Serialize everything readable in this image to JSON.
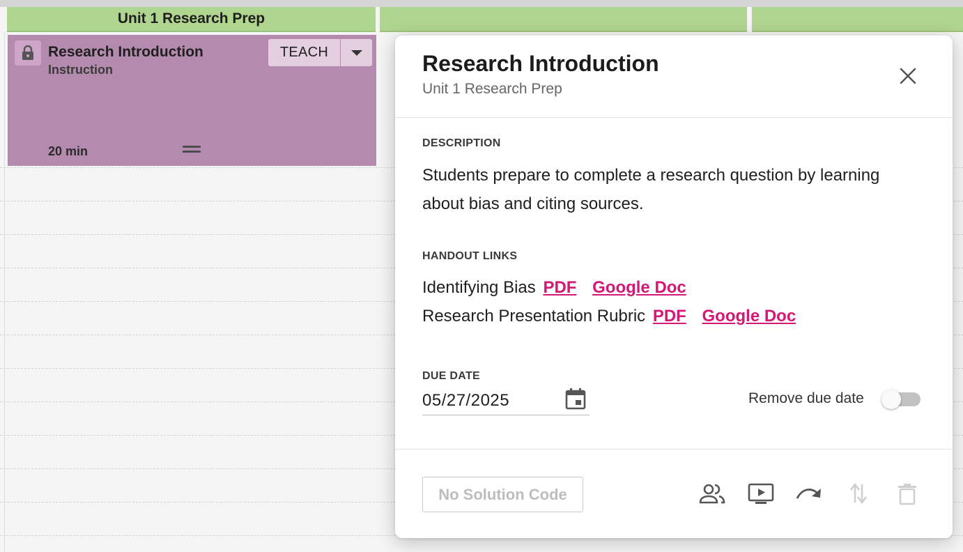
{
  "calendar": {
    "unit_headers": [
      "Unit 1 Research Prep",
      "",
      ""
    ],
    "lesson_card": {
      "title": "Research Introduction",
      "type": "Instruction",
      "duration": "20 min",
      "teach_label": "TEACH",
      "color": "#b48aae",
      "icons": [
        "lock-icon",
        "caret-down-icon",
        "drag-handle-icon"
      ]
    }
  },
  "panel": {
    "title": "Research Introduction",
    "subtitle": "Unit 1 Research Prep",
    "description_label": "DESCRIPTION",
    "description": "Students prepare to complete a research question by learning about bias and citing sources.",
    "handout_label": "HANDOUT LINKS",
    "handouts": [
      {
        "name": "Identifying Bias",
        "links": [
          "PDF",
          "Google Doc"
        ]
      },
      {
        "name": "Research Presentation Rubric",
        "links": [
          "PDF",
          "Google Doc"
        ]
      }
    ],
    "due_date_label": "DUE DATE",
    "due_date_value": "05/27/2025",
    "remove_due_date_label": "Remove due date",
    "remove_due_date_on": false,
    "solution_code_label": "No Solution Code",
    "link_color": "#d41876",
    "action_icons": [
      "close-icon",
      "calendar-icon",
      "group-icon",
      "present-icon",
      "redo-arrow-icon",
      "swap-vertical-icon",
      "delete-icon"
    ]
  }
}
